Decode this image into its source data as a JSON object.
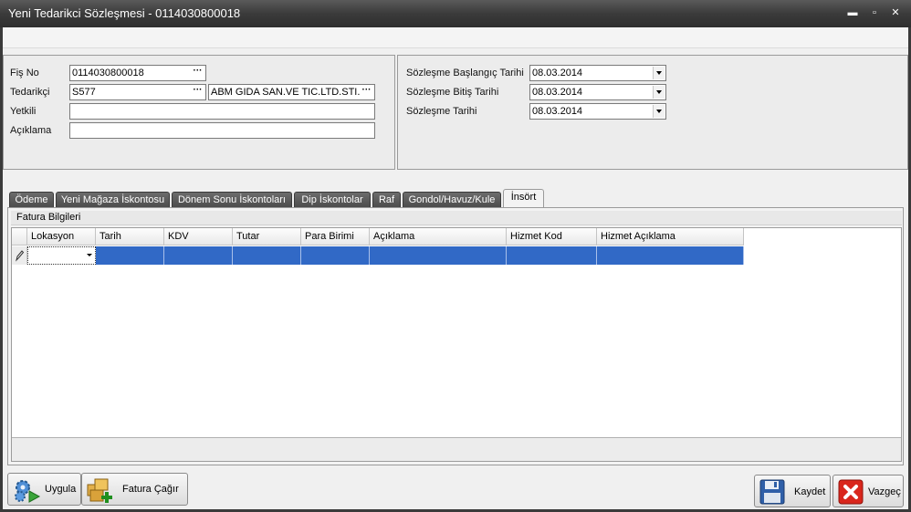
{
  "window": {
    "title": "Yeni Tedarikci Sözleşmesi - 0114030800018",
    "minimize_glyph": "▬",
    "maximize_glyph": "▫",
    "close_glyph": "✕"
  },
  "form": {
    "fis_no_label": "Fiş No",
    "fis_no_value": "0114030800018",
    "tedarikci_label": "Tedarikçi",
    "tedarikci_code": "S577",
    "tedarikci_name": "ABM GIDA SAN.VE TIC.LTD.STI.",
    "yetkili_label": "Yetkili",
    "yetkili_value": "",
    "aciklama_label": "Açıklama",
    "aciklama_value": "",
    "ellipsis": "···"
  },
  "dates": {
    "start_label": "Sözleşme Başlangıç Tarihi",
    "start_value": "08.03.2014",
    "end_label": "Sözleşme Bitiş Tarihi",
    "end_value": "08.03.2014",
    "contract_label": "Sözleşme Tarihi",
    "contract_value": "08.03.2014"
  },
  "tabs": [
    {
      "label": "Ödeme",
      "active": false
    },
    {
      "label": "Yeni Mağaza İskontosu",
      "active": false
    },
    {
      "label": "Dönem Sonu İskontoları",
      "active": false
    },
    {
      "label": "Dip İskontolar",
      "active": false
    },
    {
      "label": "Raf",
      "active": false
    },
    {
      "label": "Gondol/Havuz/Kule",
      "active": false
    },
    {
      "label": "İnsört",
      "active": true
    }
  ],
  "group_title": "Fatura Bilgileri",
  "grid": {
    "columns": [
      "Lokasyon",
      "Tarih",
      "KDV",
      "Tutar",
      "Para Birimi",
      "Açıklama",
      "Hizmet Kod",
      "Hizmet Açıklama"
    ],
    "row": {
      "lokasyon": "",
      "tarih": "",
      "kdv": "",
      "tutar": "",
      "para_birimi": "",
      "aciklama": "",
      "hizmet_kod": "",
      "hizmet_aciklama": ""
    },
    "row_indicator_icon": "pencil-icon"
  },
  "buttons": {
    "uygula": "Uygula",
    "fatura_cagir": "Fatura Çağır",
    "kaydet": "Kaydet",
    "vazgec": "Vazgeç"
  },
  "colors": {
    "selection": "#3169c6",
    "titlebar": "#3b3b3b"
  }
}
